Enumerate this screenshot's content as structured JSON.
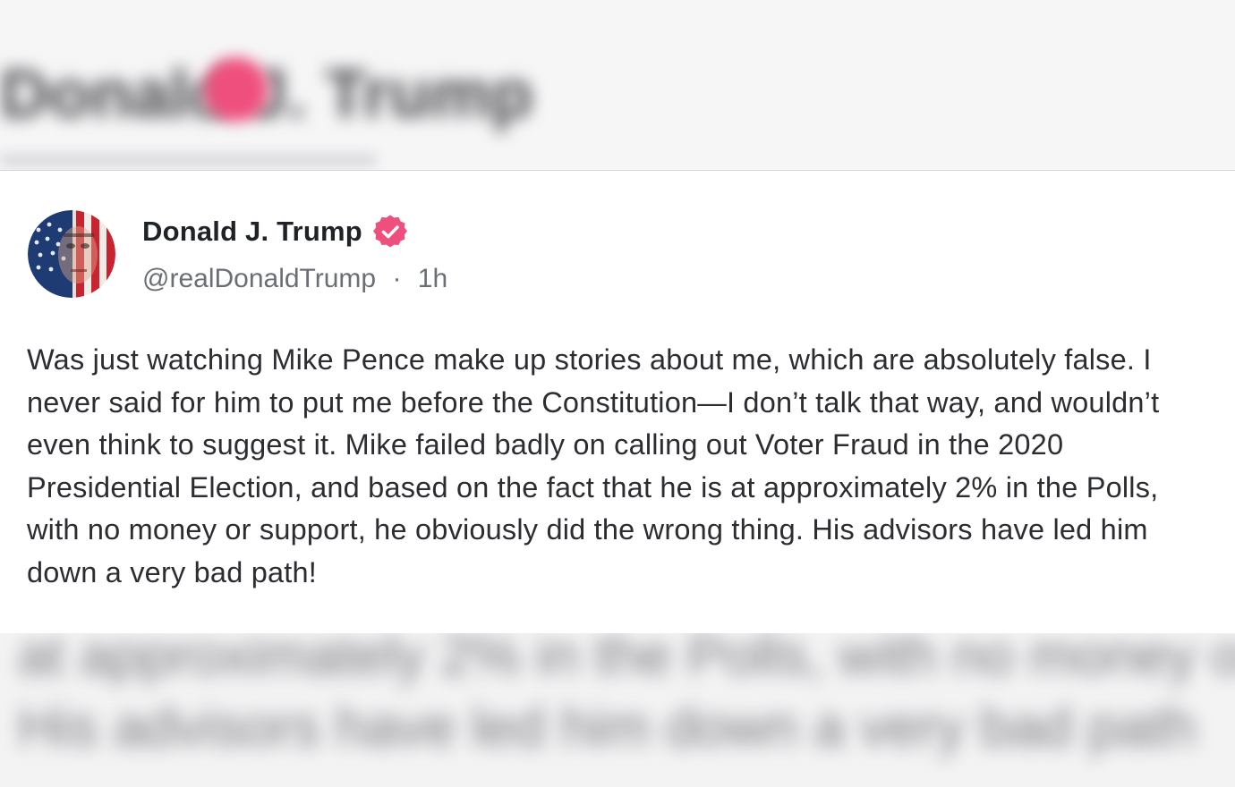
{
  "post": {
    "display_name": "Donald J. Trump",
    "handle": "@realDonaldTrump",
    "separator": "·",
    "time": "1h",
    "text": "Was just watching Mike Pence make up stories about me, which are absolutely false. I never said for him to put me before the Constitution—I don’t talk that way, and wouldn’t even think to suggest it. Mike failed badly on calling out Voter Fraud in the 2020 Presidential Election, and based on the fact that he is at approximately 2% in the Polls, with no money or support, he obviously did the wrong thing. His advisors have led him down a very bad path!",
    "avatar_icon": "flag-face-avatar",
    "verified_icon": "verified-badge-icon"
  },
  "colors": {
    "verified_badge": "#ee4f7c",
    "name_text": "#1f2328",
    "meta_text": "#6b6e75",
    "body_text": "#2b2d31"
  }
}
